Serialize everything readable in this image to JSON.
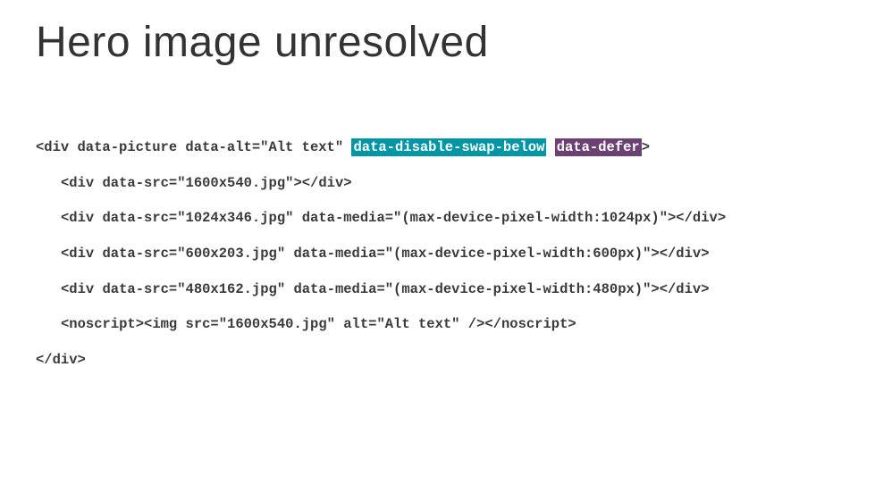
{
  "title": "Hero image unresolved",
  "code": {
    "open_prefix": "<div data-picture data-alt=\"Alt text\" ",
    "hl1": "data-disable-swap-below",
    "sep": " ",
    "hl2": "data-defer",
    "open_suffix": ">",
    "lines": [
      "<div data-src=\"1600x540.jpg\"></div>",
      "<div data-src=\"1024x346.jpg\" data-media=\"(max-device-pixel-width:1024px)\"></div>",
      "<div data-src=\"600x203.jpg\" data-media=\"(max-device-pixel-width:600px)\"></div>",
      "<div data-src=\"480x162.jpg\" data-media=\"(max-device-pixel-width:480px)\"></div>",
      "<noscript><img src=\"1600x540.jpg\" alt=\"Alt text\" /></noscript>"
    ],
    "close": "</div>"
  }
}
